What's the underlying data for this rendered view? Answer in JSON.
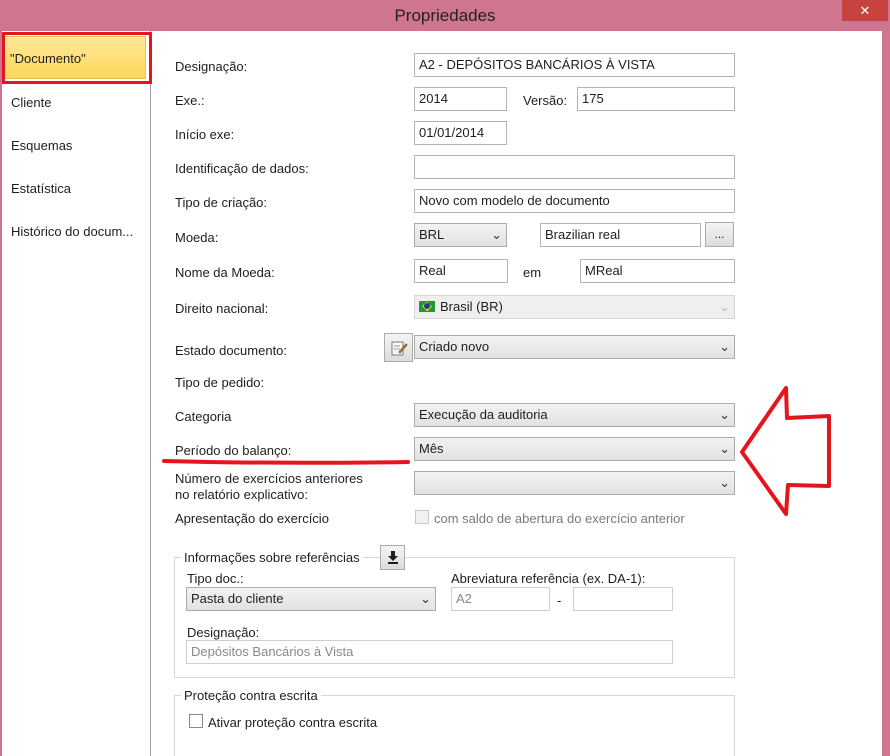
{
  "window": {
    "title": "Propriedades",
    "close_glyph": "✕"
  },
  "sidebar": {
    "items": [
      {
        "label": "\"Documento\"",
        "selected": true
      },
      {
        "label": "Cliente"
      },
      {
        "label": "Esquemas"
      },
      {
        "label": "Estatística"
      },
      {
        "label": "Histórico do docum..."
      }
    ]
  },
  "form": {
    "designacao": {
      "label": "Designação:",
      "value": "A2 - DEPÓSITOS BANCÁRIOS À VISTA"
    },
    "exe": {
      "label": "Exe.:",
      "value": "2014"
    },
    "versao": {
      "label": "Versão:",
      "value": "175"
    },
    "inicio_exe": {
      "label": "Início exe:",
      "value": "01/01/2014"
    },
    "identificacao": {
      "label": "Identificação de dados:",
      "value": ""
    },
    "tipo_criacao": {
      "label": "Tipo de criação:",
      "value": "Novo com modelo de documento"
    },
    "moeda": {
      "label": "Moeda:",
      "value": "BRL",
      "name_value": "Brazilian real",
      "browse_label": "..."
    },
    "nome_moeda": {
      "label": "Nome da Moeda:",
      "value": "Real",
      "em_label": "em",
      "em_value": "MReal"
    },
    "direito_nacional": {
      "label": "Direito nacional:",
      "value": "Brasil (BR)"
    },
    "estado_documento": {
      "label": "Estado documento:",
      "value": "Criado novo"
    },
    "tipo_pedido": {
      "label": "Tipo de pedido:"
    },
    "categoria": {
      "label": "Categoria",
      "value": "Execução da auditoria"
    },
    "periodo_balanco": {
      "label": "Período do balanço:",
      "value": "Mês"
    },
    "numero_exercicios": {
      "label_line1": "Número de exercícios anteriores",
      "label_line2": "no relatório explicativo:",
      "value": ""
    },
    "apresentacao": {
      "label": "Apresentação do exercício",
      "checkbox_label": "com saldo de abertura do exercício anterior",
      "checked": false
    }
  },
  "referencias": {
    "title": "Informações sobre referências",
    "tipo_doc_label": "Tipo doc.:",
    "tipo_doc_value": "Pasta do cliente",
    "abreviatura_label": "Abreviatura referência (ex. DA-1):",
    "abreviatura_value": "A2",
    "dash": "-",
    "abreviatura_value2": "",
    "designacao_label": "Designação:",
    "designacao_value": "Depósitos Bancários à Vista"
  },
  "protecao": {
    "title": "Proteção contra escrita",
    "checkbox_label": "Ativar proteção contra escrita",
    "checked": false
  },
  "annotations": {
    "color": "#e5151d"
  },
  "icons": {
    "dropdown": "chevron-down-icon",
    "edit": "edit-document-icon",
    "download": "download-arrow-icon"
  }
}
